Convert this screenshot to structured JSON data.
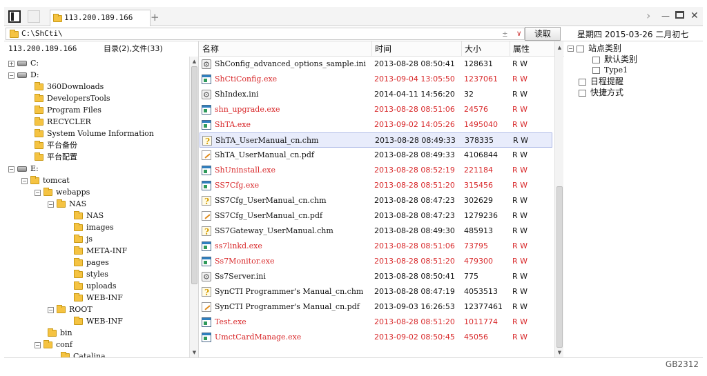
{
  "tab": {
    "title": "113.200.189.166"
  },
  "address": {
    "path": "C:\\ShCti\\",
    "go_label": "读取"
  },
  "date_text": "星期四 2015-03-26 二月初七",
  "left": {
    "host": "113.200.189.166",
    "counts": "目录(2),文件(33)",
    "tree": [
      {
        "label": "C:",
        "type": "drive",
        "expander": "+"
      },
      {
        "label": "D:",
        "type": "drive",
        "expander": "-"
      },
      {
        "label": "360Downloads",
        "type": "folder",
        "expander": ""
      },
      {
        "label": "DevelopersTools",
        "type": "folder",
        "expander": ""
      },
      {
        "label": "Program Files",
        "type": "folder",
        "expander": ""
      },
      {
        "label": "RECYCLER",
        "type": "folder",
        "expander": ""
      },
      {
        "label": "System Volume Information",
        "type": "folder",
        "expander": ""
      },
      {
        "label": "平台备份",
        "type": "folder",
        "expander": ""
      },
      {
        "label": "平台配置",
        "type": "folder",
        "expander": ""
      },
      {
        "label": "E:",
        "type": "drive",
        "expander": "-"
      },
      {
        "label": "tomcat",
        "type": "folder",
        "expander": "-"
      },
      {
        "label": "webapps",
        "type": "folder",
        "expander": "-"
      },
      {
        "label": "NAS",
        "type": "folder",
        "expander": "-"
      },
      {
        "label": "NAS",
        "type": "folder",
        "expander": ""
      },
      {
        "label": "images",
        "type": "folder",
        "expander": ""
      },
      {
        "label": "js",
        "type": "folder",
        "expander": ""
      },
      {
        "label": "META-INF",
        "type": "folder",
        "expander": ""
      },
      {
        "label": "pages",
        "type": "folder",
        "expander": ""
      },
      {
        "label": "styles",
        "type": "folder",
        "expander": ""
      },
      {
        "label": "uploads",
        "type": "folder",
        "expander": ""
      },
      {
        "label": "WEB-INF",
        "type": "folder",
        "expander": ""
      },
      {
        "label": "ROOT",
        "type": "folder",
        "expander": "-"
      },
      {
        "label": "WEB-INF",
        "type": "folder",
        "expander": ""
      },
      {
        "label": "bin",
        "type": "folder",
        "expander": ""
      },
      {
        "label": "conf",
        "type": "folder",
        "expander": "-"
      },
      {
        "label": "Catalina",
        "type": "folder",
        "expander": ""
      }
    ]
  },
  "files": {
    "columns": {
      "name": "名称",
      "time": "时间",
      "size": "大小",
      "attr": "属性"
    },
    "rows": [
      {
        "name": "ShConfig_advanced_options_sample.ini",
        "time": "2013-08-28 08:50:41",
        "size": "128631",
        "attr": "R W",
        "icon": "ini",
        "red": false
      },
      {
        "name": "ShCtiConfig.exe",
        "time": "2013-09-04 13:05:50",
        "size": "1237061",
        "attr": "R W",
        "icon": "exe",
        "red": true
      },
      {
        "name": "ShIndex.ini",
        "time": "2014-04-11 14:56:20",
        "size": "32",
        "attr": "R W",
        "icon": "ini",
        "red": false
      },
      {
        "name": "shn_upgrade.exe",
        "time": "2013-08-28 08:51:06",
        "size": "24576",
        "attr": "R W",
        "icon": "exe",
        "red": true
      },
      {
        "name": "ShTA.exe",
        "time": "2013-09-02 14:05:26",
        "size": "1495040",
        "attr": "R W",
        "icon": "exe",
        "red": true
      },
      {
        "name": "ShTA_UserManual_cn.chm",
        "time": "2013-08-28 08:49:33",
        "size": "378335",
        "attr": "R W",
        "icon": "chm",
        "red": false,
        "selected": true
      },
      {
        "name": "ShTA_UserManual_cn.pdf",
        "time": "2013-08-28 08:49:33",
        "size": "4106844",
        "attr": "R W",
        "icon": "pdf",
        "red": false
      },
      {
        "name": "ShUninstall.exe",
        "time": "2013-08-28 08:52:19",
        "size": "221184",
        "attr": "R W",
        "icon": "exe",
        "red": true
      },
      {
        "name": "SS7Cfg.exe",
        "time": "2013-08-28 08:51:20",
        "size": "315456",
        "attr": "R W",
        "icon": "exe",
        "red": true
      },
      {
        "name": "SS7Cfg_UserManual_cn.chm",
        "time": "2013-08-28 08:47:23",
        "size": "302629",
        "attr": "R W",
        "icon": "chm",
        "red": false
      },
      {
        "name": "SS7Cfg_UserManual_cn.pdf",
        "time": "2013-08-28 08:47:23",
        "size": "1279236",
        "attr": "R W",
        "icon": "pdf",
        "red": false
      },
      {
        "name": "SS7Gateway_UserManual.chm",
        "time": "2013-08-28 08:49:30",
        "size": "485913",
        "attr": "R W",
        "icon": "chm",
        "red": false
      },
      {
        "name": "ss7linkd.exe",
        "time": "2013-08-28 08:51:06",
        "size": "73795",
        "attr": "R W",
        "icon": "exe",
        "red": true
      },
      {
        "name": "Ss7Monitor.exe",
        "time": "2013-08-28 08:51:20",
        "size": "479300",
        "attr": "R W",
        "icon": "exe",
        "red": true
      },
      {
        "name": "Ss7Server.ini",
        "time": "2013-08-28 08:50:41",
        "size": "775",
        "attr": "R W",
        "icon": "ini",
        "red": false
      },
      {
        "name": "SynCTI Programmer's Manual_cn.chm",
        "time": "2013-08-28 08:47:19",
        "size": "4053513",
        "attr": "R W",
        "icon": "chm",
        "red": false
      },
      {
        "name": "SynCTI Programmer's Manual_cn.pdf",
        "time": "2013-09-03 16:26:53",
        "size": "12377461",
        "attr": "R W",
        "icon": "pdf",
        "red": false
      },
      {
        "name": "Test.exe",
        "time": "2013-08-28 08:51:20",
        "size": "1011774",
        "attr": "R W",
        "icon": "exe",
        "red": true
      },
      {
        "name": "UmctCardManage.exe",
        "time": "2013-09-02 08:50:45",
        "size": "45056",
        "attr": "R W",
        "icon": "exe",
        "red": true
      }
    ]
  },
  "side": {
    "items": [
      {
        "label": "站点类别",
        "expander": "-"
      },
      {
        "label": "默认类别",
        "expander": ""
      },
      {
        "label": "Type1",
        "expander": ""
      },
      {
        "label": "日程提醒",
        "expander": ""
      },
      {
        "label": "快捷方式",
        "expander": ""
      }
    ]
  },
  "status": {
    "encoding": "GB2312"
  },
  "colors": {
    "red_text": "#d8282a",
    "selected_bg": "#e8ecfb"
  }
}
